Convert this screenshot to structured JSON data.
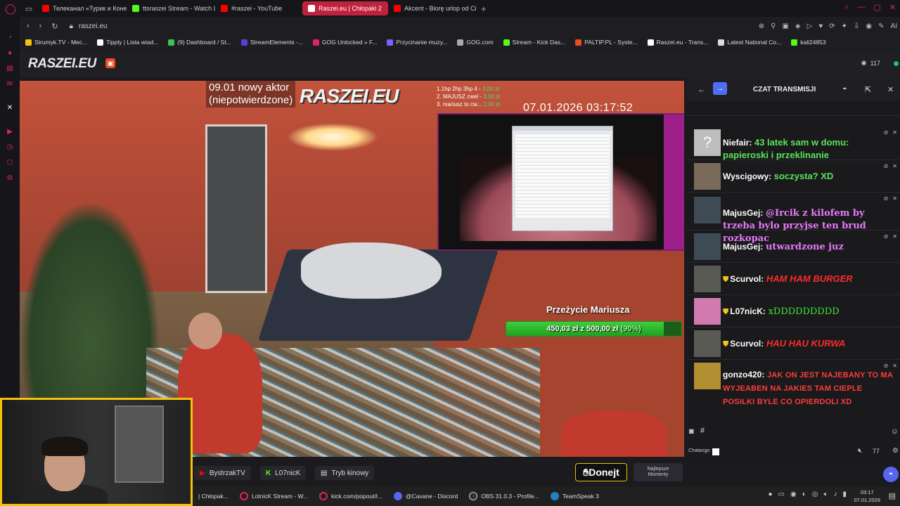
{
  "browser": {
    "tabs": [
      {
        "label": "Телеканал «Турик и Коне",
        "color": "#ff0000",
        "active": false
      },
      {
        "label": "ttsraszei Stream - Watch L",
        "color": "#53fc18",
        "active": false
      },
      {
        "label": "#raszei - YouTube",
        "color": "#ff0000",
        "active": false
      },
      {
        "label": "Raszei.eu | Chłopaki 2",
        "color": "#ffffff",
        "active": true
      },
      {
        "label": "Akcent - Biorę urlop od Ci",
        "color": "#ff0000",
        "active": false
      }
    ],
    "new_tab": "+",
    "url": "raszei.eu",
    "bookmarks": [
      {
        "label": "Strumyk.TV - Mec...",
        "color": "#f4c20d"
      },
      {
        "label": "Tipply | Lista wiad...",
        "color": "#ffffff"
      },
      {
        "label": "(9) Dashboard / St...",
        "color": "#3ac35a"
      },
      {
        "label": "StreamElements -...",
        "color": "#5f3bd9"
      },
      {
        "label": "GOG Unlocked » F...",
        "color": "#e0245e"
      },
      {
        "label": "Przycinanie muzy...",
        "color": "#7b61ff"
      },
      {
        "label": "GOG.com",
        "color": "#aaaaaa"
      },
      {
        "label": "Stream - Kick Das...",
        "color": "#53fc18"
      },
      {
        "label": "PALTIP.PL - Syste...",
        "color": "#e84d1c"
      },
      {
        "label": "Raszei.eu - Trans...",
        "color": "#ffffff"
      },
      {
        "label": "Latest National Co...",
        "color": "#dddddd"
      },
      {
        "label": "kali24853",
        "color": "#53fc18"
      }
    ]
  },
  "site": {
    "logo": "RASZEI.EU",
    "viewers": "117"
  },
  "overlay": {
    "new_actor_line1": "09.01 nowy aktor",
    "new_actor_line2": "(niepotwierdzone)",
    "logo": "RASZEI.EU",
    "top_donors": [
      {
        "label": "1.1hp 2hp 3hp 4 -",
        "amount": "3,00 zł"
      },
      {
        "label": "2. MAJUSZ cwel -",
        "amount": "3,00 zł"
      },
      {
        "label": "3. mariusz to cw...",
        "amount": "2,00 zł"
      }
    ],
    "clock": "07.01.2026 03:17:52",
    "goal_title": "Przeżycie Mariusza",
    "goal_text": "450,03 zł z 500,00 zł",
    "goal_percent_label": "(90%)",
    "goal_fraction": 0.9
  },
  "below_video": {
    "tag1": "BystrzakTV",
    "tag2": "L07nicK",
    "tag3": "Tryb kinowy",
    "donate": "Donejt",
    "best_line1": "Najlepsze",
    "best_line2": "Momenty"
  },
  "chat": {
    "title": "CZAT TRANSMISJI",
    "messages": [
      {
        "user": "Niefair:",
        "text": "43 latek sam w domu: papieroski i przeklinanie",
        "style": "green",
        "avatar": "?",
        "mod": true,
        "shield": false
      },
      {
        "user": "Wyscigowy:",
        "text": "soczysta? XD",
        "style": "green",
        "avatar": "face",
        "mod": true,
        "shield": false
      },
      {
        "user": "MajusGej:",
        "text": "@Ircik z kilofem by trzeba bylo przyjse ten brud rozkopac",
        "style": "pink",
        "avatar": "face",
        "mod": true,
        "shield": false
      },
      {
        "user": "MajusGej:",
        "text": "utwardzone juz",
        "style": "pink",
        "avatar": "face",
        "mod": true,
        "shield": false
      },
      {
        "user": "Scurvol:",
        "text": "HAM HAM BURGER",
        "style": "red",
        "avatar": "face",
        "mod": false,
        "shield": true
      },
      {
        "user": "L07nicK:",
        "text": "xDDDDDDDDD",
        "style": "ltgreen",
        "avatar": "face",
        "mod": false,
        "shield": true
      },
      {
        "user": "Scurvol:",
        "text": "HAU HAU KURWA",
        "style": "red",
        "avatar": "face",
        "mod": false,
        "shield": true
      },
      {
        "user": "gonzo420:",
        "text": "JAK ON JEST NAJEBANY TO MA WYJEABEN NA JAKIES TAM CIEPLE POSILKI BYLE CO OPIERDOLI XD",
        "style": "redcaps",
        "avatar": "face",
        "mod": true,
        "shield": false
      }
    ],
    "input_hash": "#",
    "footer_label": "Chatango",
    "footer_count": "77"
  },
  "taskbar": {
    "items": [
      {
        "label": "| Chłopak...",
        "color": "#e0245e"
      },
      {
        "label": "LotnicK Stream - W...",
        "color": "#e0245e"
      },
      {
        "label": "kick.com/popout/l...",
        "color": "#e0245e"
      },
      {
        "label": "@Cavane - Discord",
        "color": "#5865f2"
      },
      {
        "label": "OBS 31.0.3 - Profile...",
        "color": "#333333"
      },
      {
        "label": "TeamSpeak 3",
        "color": "#2580c3"
      }
    ],
    "time": "03:17",
    "date": "07.01.2026"
  }
}
